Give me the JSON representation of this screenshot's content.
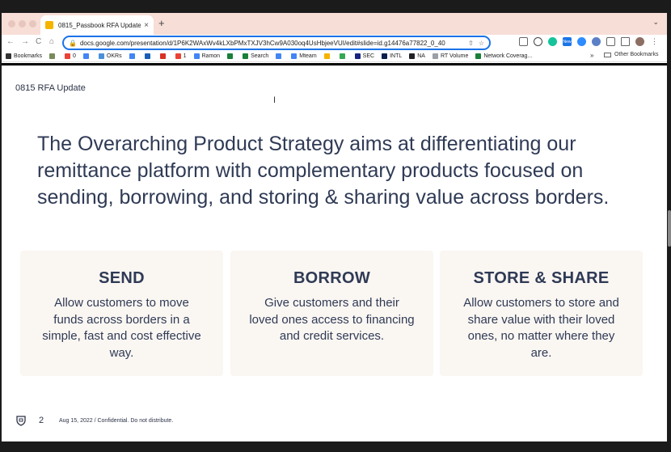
{
  "browser": {
    "tab_title": "0815_Passbook RFA Update -",
    "tab_close": "×",
    "new_tab": "+",
    "tab_menu": "⌄",
    "url": "docs.google.com/presentation/d/1P6K2WAxWv4kLXbPMxTXJV3hCw9A030oq4UsHbjeeVUI/edit#slide=id.g14476a77822_0_40",
    "nav": {
      "back": "←",
      "forward": "→",
      "reload": "C",
      "home": "⌂"
    },
    "extension_badge": "New",
    "bookmarks": [
      {
        "label": "Bookmarks",
        "color": "#333333"
      },
      {
        "label": "",
        "color": "#7a8b5b"
      },
      {
        "label": "0",
        "color": "#ea4335"
      },
      {
        "label": "",
        "color": "#4285f4"
      },
      {
        "label": "OKRs",
        "color": "#4a90d9"
      },
      {
        "label": "",
        "color": "#4285f4"
      },
      {
        "label": "",
        "color": "#1a5fb4"
      },
      {
        "label": "",
        "color": "#d93025"
      },
      {
        "label": "1",
        "color": "#ea4335"
      },
      {
        "label": "Ramon",
        "color": "#4285f4"
      },
      {
        "label": "",
        "color": "#188038"
      },
      {
        "label": "Search",
        "color": "#188038"
      },
      {
        "label": "",
        "color": "#4285f4"
      },
      {
        "label": "Mteam",
        "color": "#4285f4"
      },
      {
        "label": "",
        "color": "#f5b400"
      },
      {
        "label": "",
        "color": "#34a853"
      },
      {
        "label": "SEC",
        "color": "#1a237e"
      },
      {
        "label": "INTL",
        "color": "#0b1f4d"
      },
      {
        "label": "NA",
        "color": "#202124"
      },
      {
        "label": "RT Volume",
        "color": "#9aa0a6"
      },
      {
        "label": "Network Coverag...",
        "color": "#188038"
      }
    ],
    "bookmarks_more": "»",
    "other_bookmarks": "Other Bookmarks"
  },
  "slide": {
    "header": "0815 RFA Update",
    "headline": "The Overarching Product Strategy aims at differentiating our remittance platform with complementary products focused on sending, borrowing, and storing & sharing value across borders.",
    "cards": [
      {
        "title": "SEND",
        "desc": "Allow customers to move funds across borders in a simple, fast and cost effective way."
      },
      {
        "title": "BORROW",
        "desc": "Give customers and their loved ones access to financing and credit services."
      },
      {
        "title": "STORE & SHARE",
        "desc": "Allow customers to store and share value with their loved ones, no matter where they are."
      }
    ],
    "page_number": "2",
    "footer": "Aug 15, 2022 / Confidential. Do not distribute."
  },
  "colors": {
    "text_primary": "#2f3a55",
    "card_bg": "#faf6f2",
    "tabstrip_bg": "#f7ded6",
    "omnibox_border": "#1a73e8"
  },
  "icons": {
    "lock": "lock-icon",
    "share": "share-icon",
    "star": "star-icon",
    "logo": "shield-logo-icon",
    "cursor": "text-cursor-icon"
  }
}
